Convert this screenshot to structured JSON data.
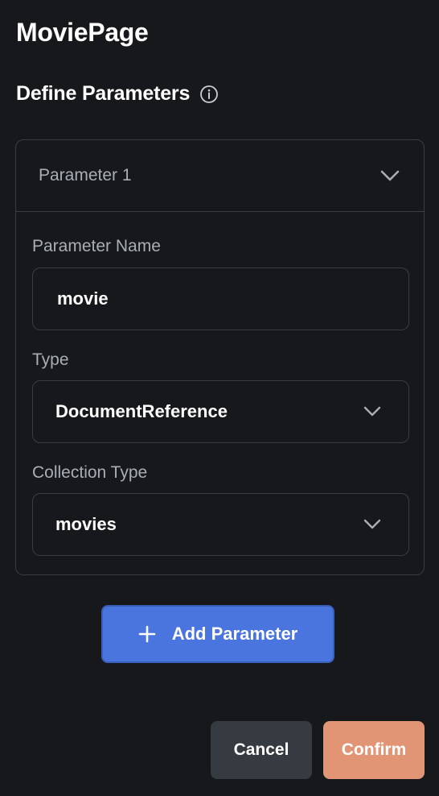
{
  "page": {
    "title": "MoviePage"
  },
  "section": {
    "title": "Define Parameters",
    "info_icon": "info-icon"
  },
  "parameter": {
    "header_label": "Parameter 1",
    "fields": {
      "name": {
        "label": "Parameter Name",
        "value": "movie"
      },
      "type": {
        "label": "Type",
        "value": "DocumentReference"
      },
      "collection": {
        "label": "Collection Type",
        "value": "movies"
      }
    }
  },
  "actions": {
    "add_parameter": "Add Parameter",
    "cancel": "Cancel",
    "confirm": "Confirm"
  },
  "colors": {
    "background": "#16181b",
    "border": "#3a3d42",
    "primary": "#4a74de",
    "cancel": "#363a41",
    "confirm": "#e29574",
    "muted_text": "#a9aeb6"
  }
}
